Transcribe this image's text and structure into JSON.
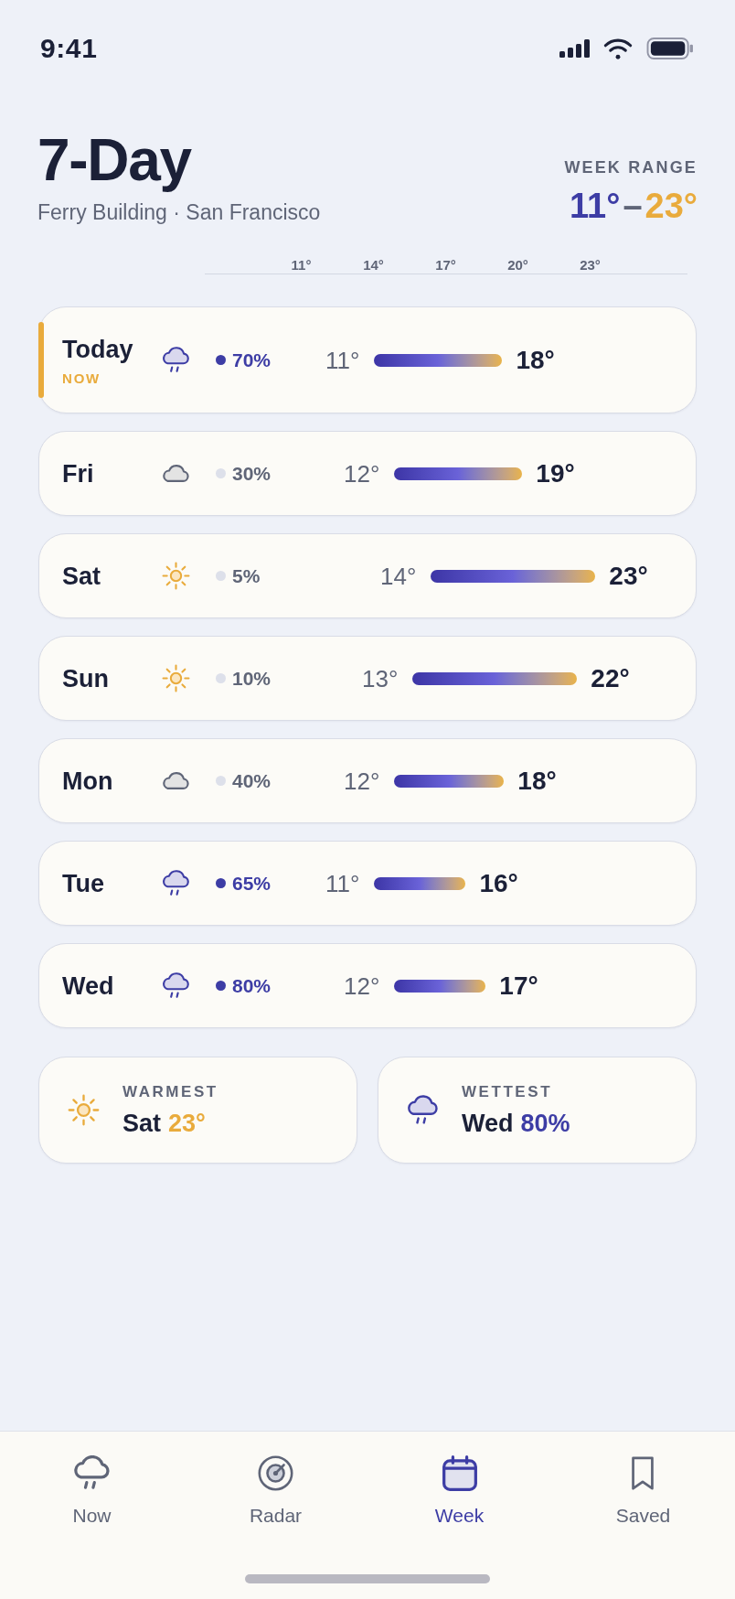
{
  "status_bar": {
    "time": "9:41"
  },
  "header": {
    "title": "7-Day",
    "location": "Ferry Building · San Francisco",
    "range_label": "WEEK RANGE",
    "range_low": "11°",
    "range_separator": "–",
    "range_high": "23°"
  },
  "scale": {
    "ticks": [
      "11°",
      "14°",
      "17°",
      "20°",
      "23°"
    ]
  },
  "days": [
    {
      "day": "Today",
      "badge": "NOW",
      "current": true,
      "kind": "rain",
      "precip": "70%",
      "low": "11°",
      "high": "18°"
    },
    {
      "day": "Fri",
      "current": false,
      "kind": "cloud",
      "precip": "30%",
      "low": "12°",
      "high": "19°"
    },
    {
      "day": "Sat",
      "current": false,
      "kind": "sun",
      "precip": "5%",
      "low": "14°",
      "high": "23°"
    },
    {
      "day": "Sun",
      "current": false,
      "kind": "sun",
      "precip": "10%",
      "low": "13°",
      "high": "22°"
    },
    {
      "day": "Mon",
      "current": false,
      "kind": "cloud",
      "precip": "40%",
      "low": "12°",
      "high": "18°"
    },
    {
      "day": "Tue",
      "current": false,
      "kind": "rain",
      "precip": "65%",
      "low": "11°",
      "high": "16°"
    },
    {
      "day": "Wed",
      "current": false,
      "kind": "rain",
      "precip": "80%",
      "low": "12°",
      "high": "17°"
    }
  ],
  "highlights": [
    {
      "kind": "sun",
      "label": "WARMEST",
      "day": "Sat",
      "value": "23°"
    },
    {
      "kind": "rain",
      "label": "WETTEST",
      "day": "Wed",
      "value": "80%"
    }
  ],
  "tabs": [
    {
      "label": "Now",
      "selected": false
    },
    {
      "label": "Radar",
      "selected": false
    },
    {
      "label": "Week",
      "selected": true
    },
    {
      "label": "Saved",
      "selected": false
    }
  ]
}
